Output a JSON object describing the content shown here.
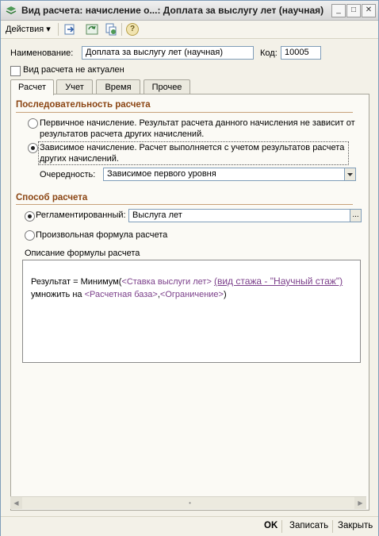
{
  "window": {
    "title": "Вид расчета: начисление о...: Доплата за выслугу лет (научная)",
    "controls": [
      "_",
      "□",
      "✕"
    ]
  },
  "toolbar": {
    "actions_label": "Действия",
    "icons": [
      "move-to-folder-icon",
      "refresh-icon",
      "copy-document-icon",
      "help-icon"
    ],
    "help_glyph": "?"
  },
  "form": {
    "name_label": "Наименование:",
    "name_value": "Доплата за выслугу лет (научная)",
    "code_label": "Код:",
    "code_value": "10005",
    "inactive_label": "Вид расчета не актуален"
  },
  "tabs": [
    "Расчет",
    "Учет",
    "Время",
    "Прочее"
  ],
  "sequence": {
    "title": "Последовательность расчета",
    "option1_line1": "Первичное начисление. Результат расчета данного начисления не зависит от",
    "option1_line2": "результатов расчета других начислений.",
    "option2_line1": "Зависимое начисление. Расчет выполняется с учетом результатов расчета",
    "option2_line2": "других начислений.",
    "order_label": "Очередность:",
    "order_value": "Зависимое первого уровня"
  },
  "method": {
    "title": "Способ расчета",
    "regulated_label": "Регламентированный:",
    "regulated_value": "Выслуга лет",
    "ellipsis": "...",
    "free_formula_label": "Произвольная формула расчета",
    "description_label": "Описание формулы расчета"
  },
  "formula": {
    "prefix": "Результат = Минимум(",
    "rate": "<Ставка выслуги лет>",
    "link": "(вид стажа - \"Научный стаж\")",
    "multiply": "умножить на",
    "base": "<Расчетная база>",
    "comma": ",",
    "limit": "<Ограничение>",
    "suffix": ")"
  },
  "bottom": {
    "ok": "OK",
    "save": "Записать",
    "close": "Закрыть"
  },
  "colors": {
    "section_title": "#8b4513",
    "link": "#7b3f8a",
    "field_border": "#7f9db9"
  }
}
